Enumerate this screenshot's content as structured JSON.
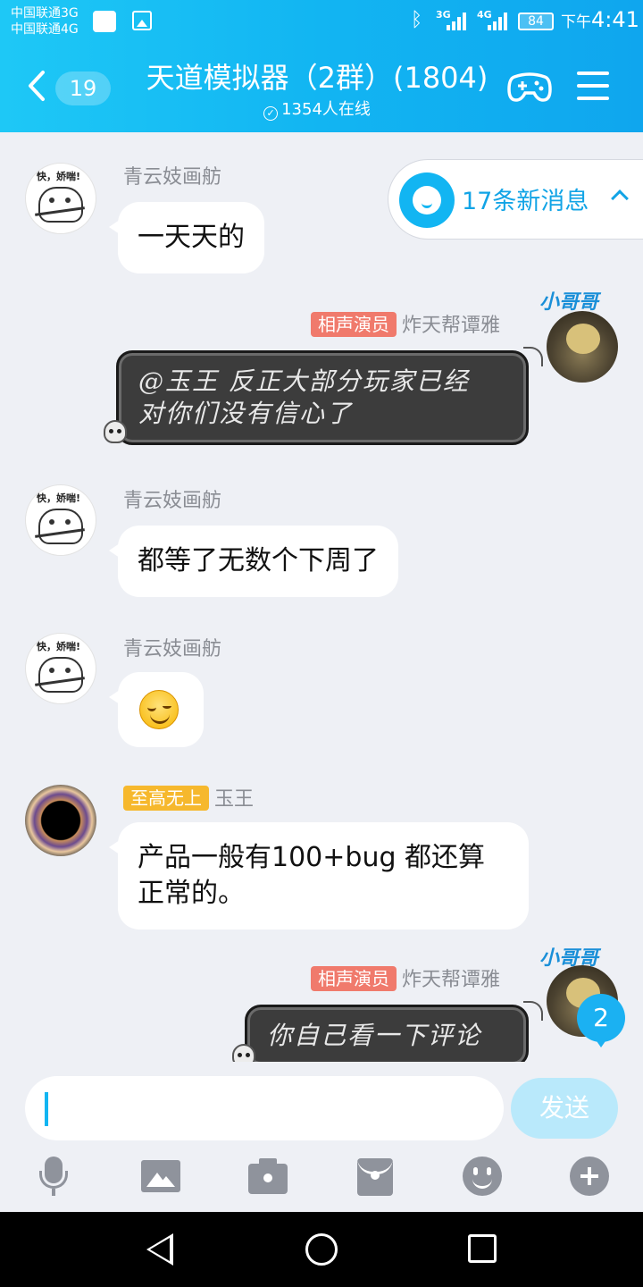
{
  "status_bar": {
    "carrier_1": "中国联通3G",
    "carrier_2": "中国联通4G",
    "net_1": "3G",
    "net_2": "4G",
    "battery": "84",
    "time_prefix": "下午",
    "time": "4:41"
  },
  "header": {
    "unread_count": "19",
    "title": "天道模拟器（2群）(1804)",
    "online": "1354人在线"
  },
  "new_messages": {
    "label": "17条新消息"
  },
  "messages": [
    {
      "sender": "青云妓画舫",
      "badge": "",
      "text": "一天天的",
      "avatar_text": "快，娇喘!"
    },
    {
      "sender": "炸天帮谭雅",
      "badge": "相声演员",
      "text": "@玉王 反正大部分玩家已经对你们没有信心了",
      "line1": "@玉王 反正大部分玩家已经",
      "line2": "对你们没有信心了",
      "tag": "小哥哥"
    },
    {
      "sender": "青云妓画舫",
      "badge": "",
      "text": "都等了无数个下周了",
      "avatar_text": "快，娇喘!"
    },
    {
      "sender": "青云妓画舫",
      "badge": "",
      "text": "",
      "avatar_text": "快，娇喘!"
    },
    {
      "sender": "玉王",
      "badge": "至高无上",
      "text": "产品一般有100+bug 都还算正常的。",
      "line1": "产品一般有100+bug 都还算",
      "line2": "正常的。"
    },
    {
      "sender": "炸天帮谭雅",
      "badge": "相声演员",
      "text": "你自己看一下评论",
      "tag": "小哥哥"
    }
  ],
  "unread_bottom": "2",
  "input": {
    "value": "",
    "send_label": "发送"
  },
  "icons": {
    "toolbar": [
      "mic-icon",
      "image-icon",
      "camera-icon",
      "red-packet-icon",
      "emoji-icon",
      "plus-icon"
    ],
    "nav": [
      "back-icon",
      "home-icon",
      "recent-apps-icon"
    ]
  },
  "colors": {
    "header": "#12b5f2",
    "accent": "#12a4e6",
    "badge_red": "#f07a6c",
    "badge_gold": "#f6b82d",
    "send_disabled": "#b9e9fb"
  }
}
